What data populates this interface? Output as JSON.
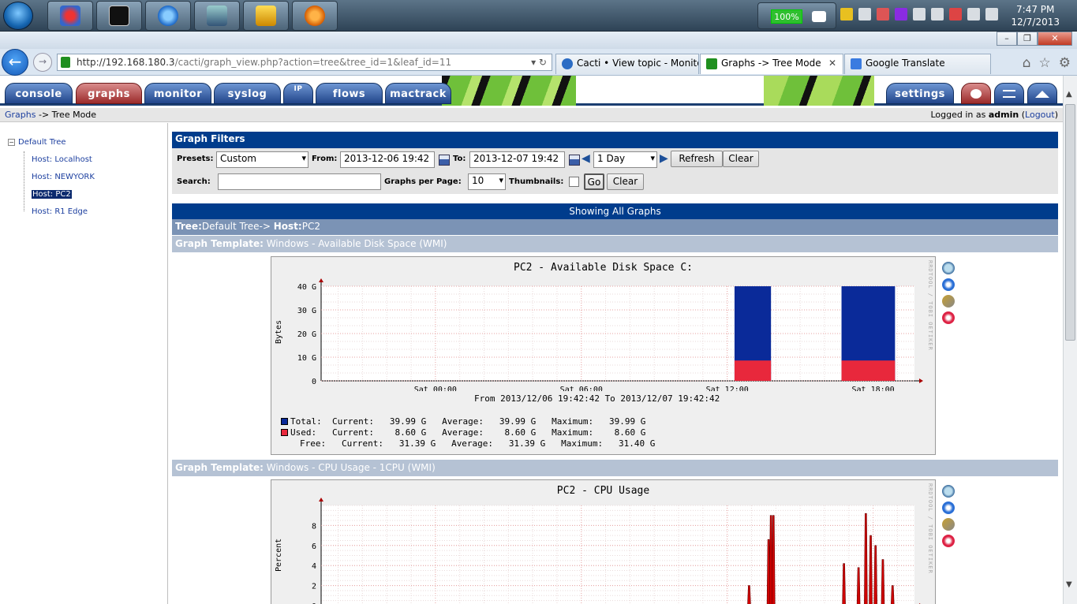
{
  "taskbar": {
    "battery": "100%",
    "time": "7:47 PM",
    "date": "12/7/2013"
  },
  "window_controls": {
    "minimize": "–",
    "maximize": "❐",
    "close": "✕"
  },
  "browser": {
    "back": "←",
    "forward": "→",
    "url_host": "http://192.168.180.3",
    "url_path": "/cacti/graph_view.php?action=tree&tree_id=1&leaf_id=11",
    "url_end": "▾ ↻",
    "tabs": [
      {
        "label": "Cacti • View topic - Monitor...",
        "icon_color": "#2b6cc4"
      },
      {
        "label": "Graphs -> Tree Mode",
        "icon_color": "#1f8f1f"
      },
      {
        "label": "Google Translate",
        "icon_color": "#3a7be0"
      }
    ],
    "tab_close": "✕",
    "icons": [
      "⌂",
      "☆",
      "⚙"
    ]
  },
  "nav": {
    "tabs": [
      "console",
      "graphs",
      "monitor",
      "syslog",
      "IP",
      "flows",
      "mactrack"
    ],
    "settings": "settings"
  },
  "breadcrumb": {
    "root": "Graphs",
    "sep": " -> ",
    "current": "Tree Mode",
    "logged_prefix": "Logged in as ",
    "user": "admin",
    "logout": "Logout"
  },
  "tree": {
    "toggle": "−",
    "root": "Default Tree",
    "items": [
      "Host: Localhost",
      "Host: NEWYORK",
      "Host: PC2",
      "Host: R1 Edge"
    ],
    "selected_index": 2
  },
  "filters": {
    "header": "Graph Filters",
    "presets_label": "Presets:",
    "presets_value": "Custom",
    "from_label": "From:",
    "from_value": "2013-12-06 19:42",
    "to_label": "To:",
    "to_value": "2013-12-07 19:42",
    "timespan_value": "1 Day",
    "refresh": "Refresh",
    "clear": "Clear",
    "search_label": "Search:",
    "search_value": "",
    "per_page_label": "Graphs per Page:",
    "per_page_value": "10",
    "thumbnails_label": "Thumbnails:",
    "go": "Go",
    "clear2": "Clear",
    "dropdown_arrow": "▾"
  },
  "showing": "Showing All Graphs",
  "tree_path": {
    "tree_label": "Tree:",
    "tree_value": "Default Tree-> ",
    "host_label": "Host:",
    "host_value": "PC2"
  },
  "graph_side_text": "RRDTOOL / TOBI OETIKER",
  "graphs": [
    {
      "template_label": "Graph Template:",
      "template_value": " Windows - Available Disk Space (WMI)",
      "title": "PC2 - Available Disk Space C:",
      "ylabel": "Bytes",
      "from_line": "From 2013/12/06 19:42:42 To 2013/12/07 19:42:42",
      "legend": [
        {
          "name": "Total:",
          "color": "#0a2a99",
          "text": "  Current:   39.99 G   Average:   39.99 G   Maximum:   39.99 G"
        },
        {
          "name": "Used:",
          "color": "#e8283c",
          "text": "   Current:    8.60 G   Average:    8.60 G   Maximum:    8.60 G"
        },
        {
          "name": "Free:",
          "color": "",
          "text": "   Current:   31.39 G   Average:   31.39 G   Maximum:   31.40 G"
        }
      ]
    },
    {
      "template_label": "Graph Template:",
      "template_value": " Windows - CPU Usage - 1CPU (WMI)",
      "title": "PC2 - CPU Usage",
      "ylabel": "Percent"
    }
  ],
  "chart_data": [
    {
      "type": "bar",
      "title": "PC2 - Available Disk Space C:",
      "ylabel": "Bytes",
      "xlabel": "",
      "x_ticks": [
        "Sat 00:00",
        "Sat 06:00",
        "Sat 12:00",
        "Sat 18:00"
      ],
      "y_ticks": [
        "0",
        "10 G",
        "20 G",
        "30 G",
        "40 G"
      ],
      "ylim": [
        0,
        40
      ],
      "x_range_hours": [
        -4.7,
        19.7
      ],
      "series": [
        {
          "name": "Total",
          "color": "#0a2a99",
          "segments": [
            {
              "x0": 12.3,
              "x1": 13.8,
              "value": 39.99
            },
            {
              "x0": 16.7,
              "x1": 18.9,
              "value": 39.99
            }
          ]
        },
        {
          "name": "Used",
          "color": "#e8283c",
          "segments": [
            {
              "x0": 12.3,
              "x1": 13.8,
              "value": 8.6
            },
            {
              "x0": 16.7,
              "x1": 18.9,
              "value": 8.6
            }
          ]
        }
      ]
    },
    {
      "type": "line",
      "title": "PC2 - CPU Usage",
      "ylabel": "Percent",
      "y_ticks": [
        "0",
        "2",
        "4",
        "6",
        "8"
      ],
      "ylim": [
        0,
        10
      ],
      "x_range_hours": [
        -4.7,
        19.7
      ],
      "series": [
        {
          "name": "",
          "color": "#d00000",
          "spikes": [
            {
              "x": 12.9,
              "value": 2.0
            },
            {
              "x": 13.7,
              "value": 6.6
            },
            {
              "x": 13.8,
              "value": 9.0
            },
            {
              "x": 13.9,
              "value": 9.0
            },
            {
              "x": 16.8,
              "value": 4.2
            },
            {
              "x": 17.4,
              "value": 3.8
            },
            {
              "x": 17.7,
              "value": 9.2
            },
            {
              "x": 17.9,
              "value": 7.0
            },
            {
              "x": 18.1,
              "value": 6.0
            },
            {
              "x": 18.4,
              "value": 4.6
            },
            {
              "x": 18.8,
              "value": 2.0
            }
          ]
        }
      ]
    }
  ]
}
